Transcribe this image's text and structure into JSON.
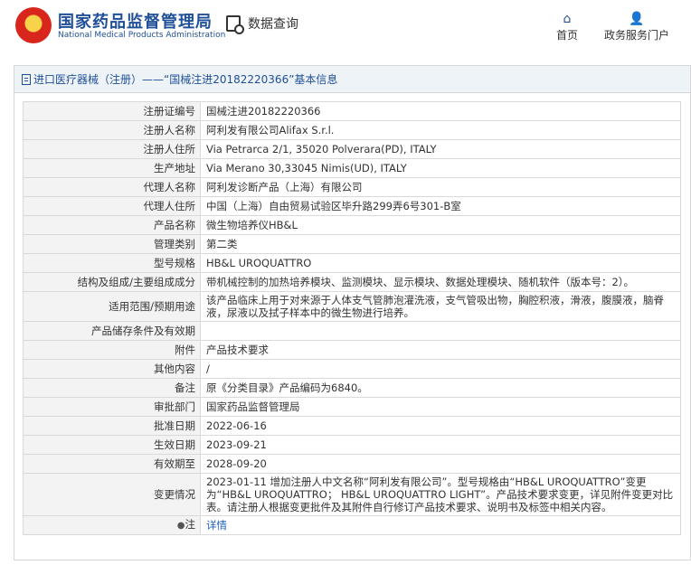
{
  "header": {
    "brand_cn": "国家药品监督管理局",
    "brand_en": "National Medical Products Administration",
    "query_label": "数据查询",
    "nav": [
      {
        "label": "首页",
        "icon": "home-icon"
      },
      {
        "label": "政务服务门户",
        "icon": "user-icon"
      }
    ]
  },
  "panel": {
    "title": "进口医疗器械（注册）——“国械注进20182220366”基本信息"
  },
  "rows": [
    {
      "label": "注册证编号",
      "value": "国械注进20182220366"
    },
    {
      "label": "注册人名称",
      "value": "阿利发有限公司Alifax S.r.l."
    },
    {
      "label": "注册人住所",
      "value": "Via Petrarca 2/1, 35020 Polverara(PD), ITALY"
    },
    {
      "label": "生产地址",
      "value": "Via Merano 30,33045 Nimis(UD), ITALY"
    },
    {
      "label": "代理人名称",
      "value": "阿利发诊断产品（上海）有限公司"
    },
    {
      "label": "代理人住所",
      "value": "中国（上海）自由贸易试验区毕升路299弄6号301-B室"
    },
    {
      "label": "产品名称",
      "value": "微生物培养仪HB&L"
    },
    {
      "label": "管理类别",
      "value": "第二类"
    },
    {
      "label": "型号规格",
      "value": "HB&L UROQUATTRO"
    },
    {
      "label": "结构及组成/主要组成成分",
      "value": "带机械控制的加热培养模块、监测模块、显示模块、数据处理模块、随机软件（版本号：2）。"
    },
    {
      "label": "适用范围/预期用途",
      "value": "该产品临床上用于对来源于人体支气管肺泡灌洗液，支气管吸出物，胸腔积液，滑液，腹膜液，脑脊液，尿液以及拭子样本中的微生物进行培养。"
    },
    {
      "label": "产品储存条件及有效期",
      "value": ""
    },
    {
      "label": "附件",
      "value": "产品技术要求"
    },
    {
      "label": "其他内容",
      "value": "/"
    },
    {
      "label": "备注",
      "value": "原《分类目录》产品编码为6840。"
    },
    {
      "label": "审批部门",
      "value": "国家药品监督管理局"
    },
    {
      "label": "批准日期",
      "value": "2022-06-16"
    },
    {
      "label": "生效日期",
      "value": "2023-09-21"
    },
    {
      "label": "有效期至",
      "value": "2028-09-20"
    },
    {
      "label": "变更情况",
      "value": "2023-01-11 增加注册人中文名称“阿利发有限公司”。型号规格由“HB&L UROQUATTRO”变更为“HB&L UROQUATTRO； HB&L UROQUATTRO LIGHT”。产品技术要求变更，详见附件变更对比表。请注册人根据变更批件及其附件自行修订产品技术要求、说明书及标签中相关内容。"
    }
  ],
  "note_row": {
    "label": "注",
    "link": "详情"
  }
}
